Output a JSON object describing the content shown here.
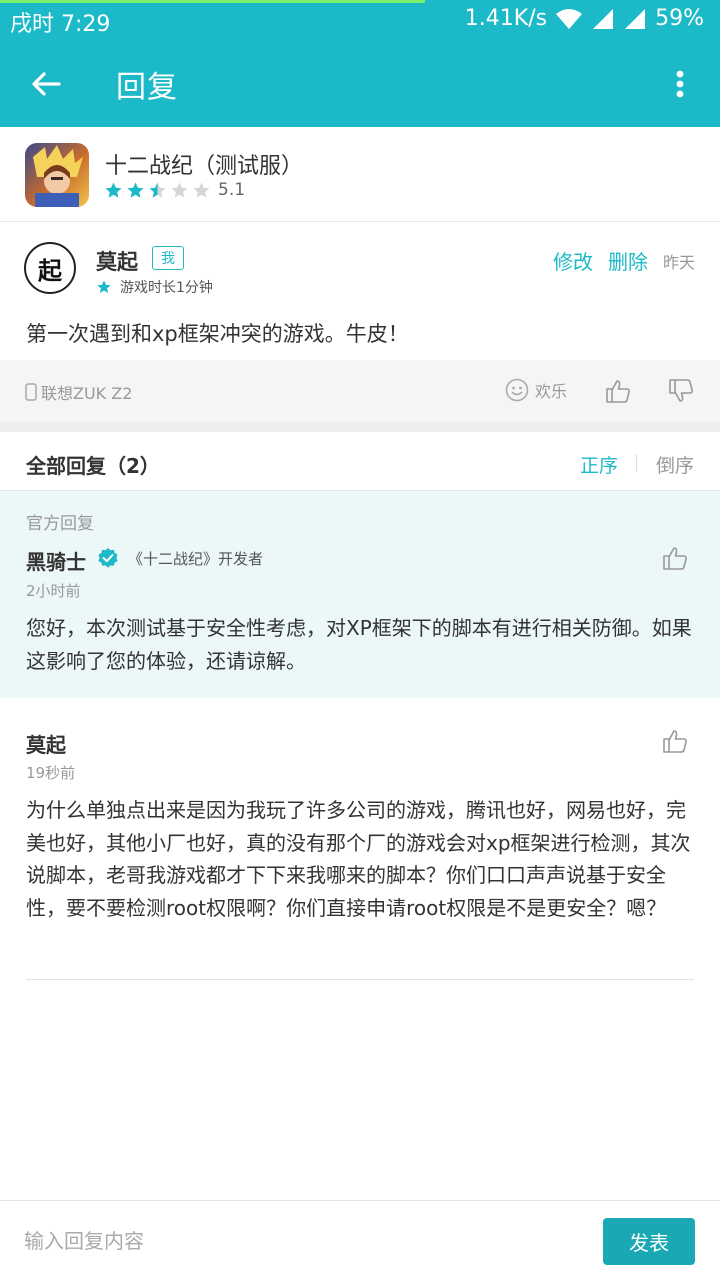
{
  "status": {
    "time": "戌时 7:29",
    "net_speed": "1.41K/s",
    "battery": "59%"
  },
  "toolbar": {
    "title": "回复"
  },
  "game": {
    "name": "十二战纪（测试服）",
    "rating": 2.5,
    "max_rating": 5,
    "score": "5.1"
  },
  "review": {
    "author": "莫起",
    "me_badge": "我",
    "avatar_char": "起",
    "playtime": "游戏时长1分钟",
    "edit_label": "修改",
    "delete_label": "删除",
    "date": "昨天",
    "text": "第一次遇到和xp框架冲突的游戏。牛皮！",
    "device": "联想ZUK Z2",
    "emote_label": "欢乐"
  },
  "replies": {
    "title": "全部回复（2）",
    "sort_asc": "正序",
    "sort_desc": "倒序",
    "official": {
      "label": "官方回复",
      "name": "黑骑士",
      "role": "《十二战纪》开发者",
      "time": "2小时前",
      "text": "您好，本次测试基于安全性考虑，对XP框架下的脚本有进行相关防御。如果这影响了您的体验，还请谅解。"
    },
    "user": {
      "name": "莫起",
      "time": "19秒前",
      "text": "为什么单独点出来是因为我玩了许多公司的游戏，腾讯也好，网易也好，完美也好，其他小厂也好，真的没有那个厂的游戏会对xp框架进行检测，其次说脚本，老哥我游戏都才下下来我哪来的脚本？你们口口声声说基于安全性，要不要检测root权限啊？你们直接申请root权限是不是更安全？嗯？"
    }
  },
  "bottom": {
    "placeholder": "输入回复内容",
    "send_label": "发表"
  },
  "colors": {
    "accent": "#1cb9c8",
    "star_on": "#1cb9c8",
    "star_off": "#d6d6d6",
    "official_bg": "#ecf7f8"
  },
  "icons": [
    "back-arrow-icon",
    "more-vert-icon",
    "wifi-icon",
    "signal-icon",
    "star-icon",
    "phone-icon",
    "smile-icon",
    "thumb-up-icon",
    "thumb-down-icon",
    "verified-icon"
  ]
}
